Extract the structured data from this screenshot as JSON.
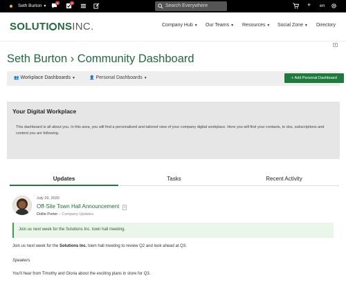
{
  "topbar": {
    "user_name": "Seth Burton",
    "notif_badge_1": "8",
    "notif_badge_2": "8",
    "search_placeholder": "Search Everywhere",
    "lang": "en"
  },
  "brand": {
    "logo_left": "SOLUTI",
    "logo_right": "NS",
    "logo_inc": "INC."
  },
  "nav": {
    "items": [
      {
        "label": "Company Hub"
      },
      {
        "label": "Our Teams"
      },
      {
        "label": "Resources"
      },
      {
        "label": "Social Zone"
      },
      {
        "label": "Directory"
      }
    ]
  },
  "page": {
    "title": "Seth Burton › Community Dashboard"
  },
  "subbar": {
    "workplace_label": "Workplace Dashboards",
    "personal_label": "Personal Dashboards",
    "add_button": "+ Add Personal Dashboard"
  },
  "digital_workplace": {
    "title": "Your Digital Workplace",
    "body": "This dashboard is all about you. In this area, you will find a personalized and tailored view of your company digital workplace. Here you will find your contacts, to dos, subscriptions and content you are following."
  },
  "tabs": [
    {
      "label": "Updates"
    },
    {
      "label": "Tasks"
    },
    {
      "label": "Recent Activity"
    }
  ],
  "post": {
    "date": "July 29, 2020",
    "title": "Off-Site Town Hall Announcement",
    "author": "Dollie Porter",
    "author_sep": "–",
    "category": "Company Updates",
    "note": "Join us next week for the Solutions Inc. town hall meeting.",
    "para1_a": "Join us next week for the ",
    "para1_b": "Solutions Inc.",
    "para1_c": " town hall meeting to review Q2 and look ahead at Q3.",
    "speakers_heading": "Speakers",
    "para2": "You'll hear from Timothy and Gloria about the exciting plans in store for Q3."
  },
  "colors": {
    "brand_green": "#1f6b3c",
    "button_green": "#1f7a3e",
    "topbar": "#000000"
  }
}
